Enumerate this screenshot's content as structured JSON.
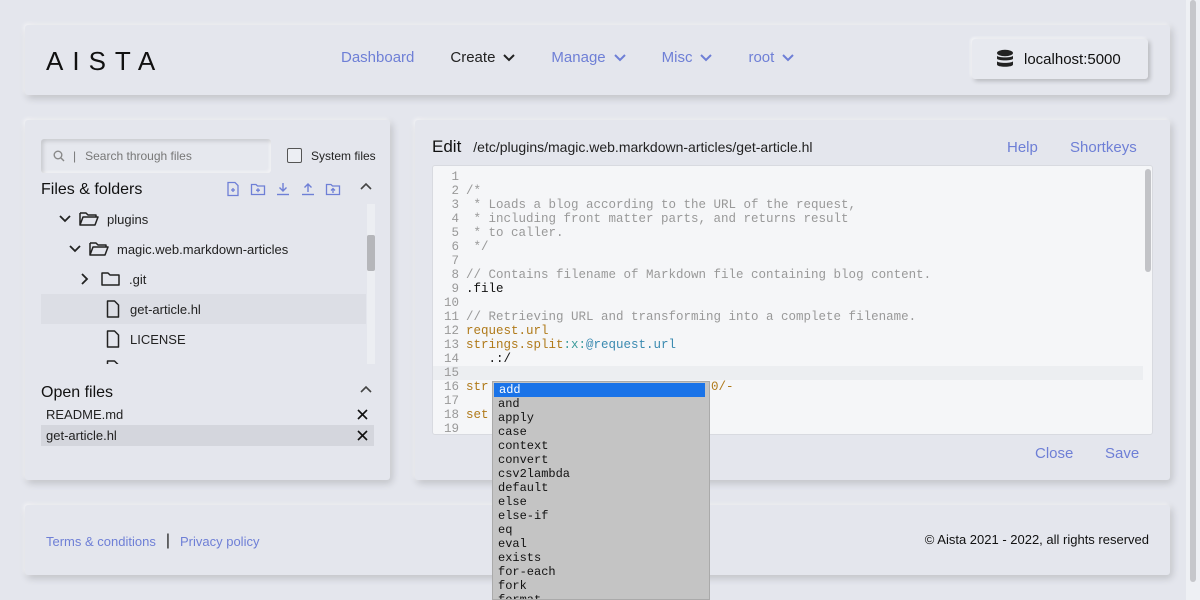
{
  "header": {
    "logo": "AISTA",
    "nav": [
      {
        "label": "Dashboard",
        "dropdown": false,
        "color": "#6e7fd6"
      },
      {
        "label": "Create",
        "dropdown": true,
        "color": "#222222"
      },
      {
        "label": "Manage",
        "dropdown": true,
        "color": "#6e7fd6"
      },
      {
        "label": "Misc",
        "dropdown": true,
        "color": "#6e7fd6"
      },
      {
        "label": "root",
        "dropdown": true,
        "color": "#6e7fd6"
      }
    ],
    "server": "localhost:5000"
  },
  "files_panel": {
    "search_placeholder": "Search through files",
    "system_files_label": "System files",
    "title": "Files & folders",
    "tree": [
      {
        "label": "plugins",
        "type": "folder",
        "expanded": true
      },
      {
        "label": "magic.web.markdown-articles",
        "type": "folder",
        "expanded": true
      },
      {
        "label": ".git",
        "type": "folder",
        "expanded": false
      },
      {
        "label": "get-article.hl",
        "type": "file",
        "selected": true
      },
      {
        "label": "LICENSE",
        "type": "file"
      }
    ],
    "open_files_title": "Open files",
    "open_files": [
      {
        "label": "README.md",
        "active": false
      },
      {
        "label": "get-article.hl",
        "active": true
      }
    ]
  },
  "editor": {
    "edit_label": "Edit",
    "path": "/etc/plugins/magic.web.markdown-articles/get-article.hl",
    "help": "Help",
    "shortkeys": "Shortkeys",
    "close": "Close",
    "save": "Save",
    "lines": [
      {
        "n": "1",
        "text": "",
        "cls": "c-plain"
      },
      {
        "n": "2",
        "text": "/*",
        "cls": "c-comment"
      },
      {
        "n": "3",
        "text": " * Loads a blog according to the URL of the request,",
        "cls": "c-comment"
      },
      {
        "n": "4",
        "text": " * including front matter parts, and returns result",
        "cls": "c-comment"
      },
      {
        "n": "5",
        "text": " * to caller.",
        "cls": "c-comment"
      },
      {
        "n": "6",
        "text": " */",
        "cls": "c-comment"
      },
      {
        "n": "7",
        "text": "",
        "cls": "c-plain"
      },
      {
        "n": "8",
        "text": "// Contains filename of Markdown file containing blog content.",
        "cls": "c-comment"
      },
      {
        "n": "9",
        "text": ".file",
        "cls": "c-plain"
      },
      {
        "n": "10",
        "text": "",
        "cls": "c-plain"
      },
      {
        "n": "11",
        "text": "// Retrieving URL and transforming into a complete filename.",
        "cls": "c-comment"
      },
      {
        "n": "12",
        "text": "request.url",
        "cls": "c-kw"
      },
      {
        "n": "13",
        "text": "strings.split:x:@request.url",
        "cls": "c-mixed"
      },
      {
        "n": "14",
        "text": "   .:/",
        "cls": "c-plain"
      },
      {
        "n": "15",
        "text": "",
        "cls": "c-plain"
      },
      {
        "n": "16",
        "text": "str",
        "suffix": "0/-",
        "cls": "c-kw"
      },
      {
        "n": "17",
        "text": "",
        "cls": "c-plain"
      },
      {
        "n": "18",
        "text": "set",
        "cls": "c-kw"
      },
      {
        "n": "19",
        "text": "",
        "cls": "c-plain"
      }
    ]
  },
  "autocomplete": {
    "items": [
      "add",
      "and",
      "apply",
      "case",
      "context",
      "convert",
      "csv2lambda",
      "default",
      "else",
      "else-if",
      "eq",
      "eval",
      "exists",
      "for-each",
      "fork",
      "format"
    ],
    "selected": "add"
  },
  "footer": {
    "terms": "Terms & conditions",
    "separator": "|",
    "privacy": "Privacy policy",
    "copyright": "© Aista 2021 - 2022, all rights reserved"
  }
}
